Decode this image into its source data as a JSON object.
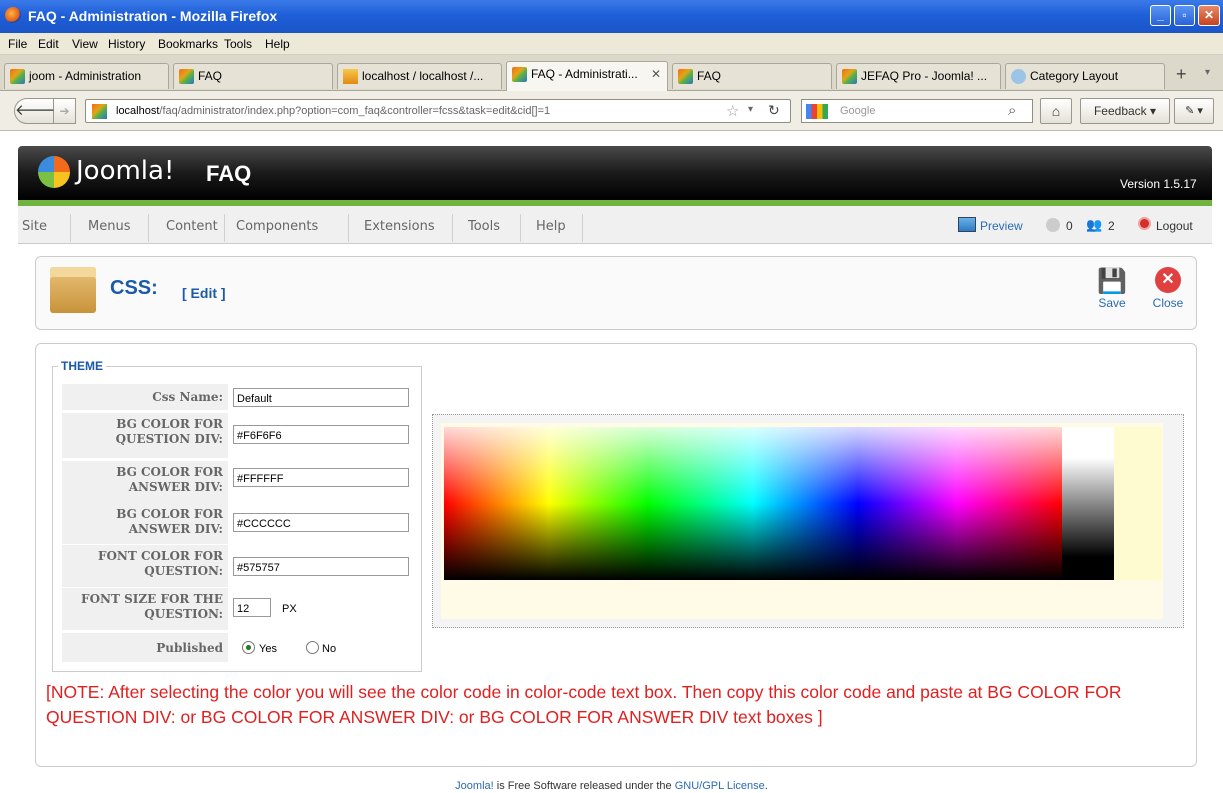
{
  "window": {
    "title": "FAQ - Administration - Mozilla Firefox"
  },
  "menubar": [
    "File",
    "Edit",
    "View",
    "History",
    "Bookmarks",
    "Tools",
    "Help"
  ],
  "tabs": [
    {
      "label": "joom - Administration",
      "icon": "joomla-favicon"
    },
    {
      "label": "FAQ",
      "icon": "joomla-favicon"
    },
    {
      "label": "localhost / localhost /...",
      "icon": "phpmyadmin-favicon"
    },
    {
      "label": "FAQ - Administrati...",
      "icon": "joomla-favicon",
      "active": true
    },
    {
      "label": "FAQ",
      "icon": "joomla-favicon"
    },
    {
      "label": "JEFAQ Pro - Joomla! ...",
      "icon": "joomla-favicon"
    },
    {
      "label": "Category Layout",
      "icon": "page-favicon"
    }
  ],
  "nav": {
    "url_host": "localhost",
    "url_path": "/faq/administrator/index.php?option=com_faq&controller=fcss&task=edit&cid[]=1",
    "search_placeholder": "Google",
    "feedback_label": "Feedback"
  },
  "joomla": {
    "brand": "Joomla!",
    "component": "FAQ",
    "version": "Version 1.5.17",
    "menu": [
      "Site",
      "Menus",
      "Content",
      "Components",
      "Extensions",
      "Tools",
      "Help"
    ],
    "preview_label": "Preview",
    "messages_count": "0",
    "users_count": "2",
    "logout_label": "Logout"
  },
  "toolbar": {
    "title": "CSS:",
    "subtitle": "[ Edit ]",
    "save_label": "Save",
    "close_label": "Close"
  },
  "form": {
    "legend": "THEME",
    "rows": [
      {
        "label": "Css Name:",
        "value": "Default"
      },
      {
        "label": "BG COLOR FOR QUESTION DIV:",
        "value": "#F6F6F6"
      },
      {
        "label": "BG COLOR FOR ANSWER DIV:",
        "value": "#FFFFFF"
      },
      {
        "label": "BG COLOR FOR ANSWER DIV:",
        "value": "#CCCCCC"
      },
      {
        "label": "FONT COLOR FOR QUESTION:",
        "value": "#575757"
      },
      {
        "label": "FONT SIZE FOR THE QUESTION:",
        "value": "12",
        "unit": "PX"
      }
    ],
    "published_label": "Published",
    "yes_label": "Yes",
    "no_label": "No",
    "published_value": "Yes"
  },
  "note": "[NOTE: After selecting the color you will see the color code in color-code text box. Then copy this color code and paste at BG COLOR FOR QUESTION DIV: or BG COLOR FOR ANSWER DIV: or BG COLOR FOR ANSWER DIV text boxes ]",
  "footer": {
    "link1": "Joomla!",
    "text": " is Free Software released under the ",
    "link2": "GNU/GPL License",
    "end": "."
  },
  "colors": {
    "accent_blue": "#1f5fd8",
    "joomla_green": "#70b43f",
    "note_red": "#e02020",
    "picker_swatch": "#fffbd0"
  }
}
